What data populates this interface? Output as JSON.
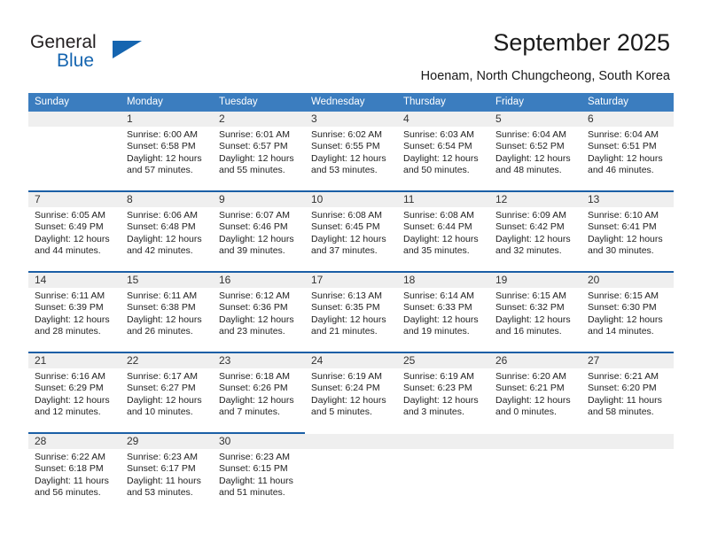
{
  "brand": {
    "name_part1": "General",
    "name_part2": "Blue",
    "accent_color": "#1565b0"
  },
  "header": {
    "title": "September 2025",
    "location": "Hoenam, North Chungcheong, South Korea"
  },
  "calendar": {
    "header_bg": "#3b7dbf",
    "weekday_headers": [
      "Sunday",
      "Monday",
      "Tuesday",
      "Wednesday",
      "Thursday",
      "Friday",
      "Saturday"
    ],
    "weeks": [
      [
        {
          "day": "",
          "sunrise": "",
          "sunset": "",
          "daylight_line1": "",
          "daylight_line2": "",
          "blank": true
        },
        {
          "day": "1",
          "sunrise": "Sunrise: 6:00 AM",
          "sunset": "Sunset: 6:58 PM",
          "daylight_line1": "Daylight: 12 hours",
          "daylight_line2": "and 57 minutes."
        },
        {
          "day": "2",
          "sunrise": "Sunrise: 6:01 AM",
          "sunset": "Sunset: 6:57 PM",
          "daylight_line1": "Daylight: 12 hours",
          "daylight_line2": "and 55 minutes."
        },
        {
          "day": "3",
          "sunrise": "Sunrise: 6:02 AM",
          "sunset": "Sunset: 6:55 PM",
          "daylight_line1": "Daylight: 12 hours",
          "daylight_line2": "and 53 minutes."
        },
        {
          "day": "4",
          "sunrise": "Sunrise: 6:03 AM",
          "sunset": "Sunset: 6:54 PM",
          "daylight_line1": "Daylight: 12 hours",
          "daylight_line2": "and 50 minutes."
        },
        {
          "day": "5",
          "sunrise": "Sunrise: 6:04 AM",
          "sunset": "Sunset: 6:52 PM",
          "daylight_line1": "Daylight: 12 hours",
          "daylight_line2": "and 48 minutes."
        },
        {
          "day": "6",
          "sunrise": "Sunrise: 6:04 AM",
          "sunset": "Sunset: 6:51 PM",
          "daylight_line1": "Daylight: 12 hours",
          "daylight_line2": "and 46 minutes."
        }
      ],
      [
        {
          "day": "7",
          "sunrise": "Sunrise: 6:05 AM",
          "sunset": "Sunset: 6:49 PM",
          "daylight_line1": "Daylight: 12 hours",
          "daylight_line2": "and 44 minutes."
        },
        {
          "day": "8",
          "sunrise": "Sunrise: 6:06 AM",
          "sunset": "Sunset: 6:48 PM",
          "daylight_line1": "Daylight: 12 hours",
          "daylight_line2": "and 42 minutes."
        },
        {
          "day": "9",
          "sunrise": "Sunrise: 6:07 AM",
          "sunset": "Sunset: 6:46 PM",
          "daylight_line1": "Daylight: 12 hours",
          "daylight_line2": "and 39 minutes."
        },
        {
          "day": "10",
          "sunrise": "Sunrise: 6:08 AM",
          "sunset": "Sunset: 6:45 PM",
          "daylight_line1": "Daylight: 12 hours",
          "daylight_line2": "and 37 minutes."
        },
        {
          "day": "11",
          "sunrise": "Sunrise: 6:08 AM",
          "sunset": "Sunset: 6:44 PM",
          "daylight_line1": "Daylight: 12 hours",
          "daylight_line2": "and 35 minutes."
        },
        {
          "day": "12",
          "sunrise": "Sunrise: 6:09 AM",
          "sunset": "Sunset: 6:42 PM",
          "daylight_line1": "Daylight: 12 hours",
          "daylight_line2": "and 32 minutes."
        },
        {
          "day": "13",
          "sunrise": "Sunrise: 6:10 AM",
          "sunset": "Sunset: 6:41 PM",
          "daylight_line1": "Daylight: 12 hours",
          "daylight_line2": "and 30 minutes."
        }
      ],
      [
        {
          "day": "14",
          "sunrise": "Sunrise: 6:11 AM",
          "sunset": "Sunset: 6:39 PM",
          "daylight_line1": "Daylight: 12 hours",
          "daylight_line2": "and 28 minutes."
        },
        {
          "day": "15",
          "sunrise": "Sunrise: 6:11 AM",
          "sunset": "Sunset: 6:38 PM",
          "daylight_line1": "Daylight: 12 hours",
          "daylight_line2": "and 26 minutes."
        },
        {
          "day": "16",
          "sunrise": "Sunrise: 6:12 AM",
          "sunset": "Sunset: 6:36 PM",
          "daylight_line1": "Daylight: 12 hours",
          "daylight_line2": "and 23 minutes."
        },
        {
          "day": "17",
          "sunrise": "Sunrise: 6:13 AM",
          "sunset": "Sunset: 6:35 PM",
          "daylight_line1": "Daylight: 12 hours",
          "daylight_line2": "and 21 minutes."
        },
        {
          "day": "18",
          "sunrise": "Sunrise: 6:14 AM",
          "sunset": "Sunset: 6:33 PM",
          "daylight_line1": "Daylight: 12 hours",
          "daylight_line2": "and 19 minutes."
        },
        {
          "day": "19",
          "sunrise": "Sunrise: 6:15 AM",
          "sunset": "Sunset: 6:32 PM",
          "daylight_line1": "Daylight: 12 hours",
          "daylight_line2": "and 16 minutes."
        },
        {
          "day": "20",
          "sunrise": "Sunrise: 6:15 AM",
          "sunset": "Sunset: 6:30 PM",
          "daylight_line1": "Daylight: 12 hours",
          "daylight_line2": "and 14 minutes."
        }
      ],
      [
        {
          "day": "21",
          "sunrise": "Sunrise: 6:16 AM",
          "sunset": "Sunset: 6:29 PM",
          "daylight_line1": "Daylight: 12 hours",
          "daylight_line2": "and 12 minutes."
        },
        {
          "day": "22",
          "sunrise": "Sunrise: 6:17 AM",
          "sunset": "Sunset: 6:27 PM",
          "daylight_line1": "Daylight: 12 hours",
          "daylight_line2": "and 10 minutes."
        },
        {
          "day": "23",
          "sunrise": "Sunrise: 6:18 AM",
          "sunset": "Sunset: 6:26 PM",
          "daylight_line1": "Daylight: 12 hours",
          "daylight_line2": "and 7 minutes."
        },
        {
          "day": "24",
          "sunrise": "Sunrise: 6:19 AM",
          "sunset": "Sunset: 6:24 PM",
          "daylight_line1": "Daylight: 12 hours",
          "daylight_line2": "and 5 minutes."
        },
        {
          "day": "25",
          "sunrise": "Sunrise: 6:19 AM",
          "sunset": "Sunset: 6:23 PM",
          "daylight_line1": "Daylight: 12 hours",
          "daylight_line2": "and 3 minutes."
        },
        {
          "day": "26",
          "sunrise": "Sunrise: 6:20 AM",
          "sunset": "Sunset: 6:21 PM",
          "daylight_line1": "Daylight: 12 hours",
          "daylight_line2": "and 0 minutes."
        },
        {
          "day": "27",
          "sunrise": "Sunrise: 6:21 AM",
          "sunset": "Sunset: 6:20 PM",
          "daylight_line1": "Daylight: 11 hours",
          "daylight_line2": "and 58 minutes."
        }
      ],
      [
        {
          "day": "28",
          "sunrise": "Sunrise: 6:22 AM",
          "sunset": "Sunset: 6:18 PM",
          "daylight_line1": "Daylight: 11 hours",
          "daylight_line2": "and 56 minutes."
        },
        {
          "day": "29",
          "sunrise": "Sunrise: 6:23 AM",
          "sunset": "Sunset: 6:17 PM",
          "daylight_line1": "Daylight: 11 hours",
          "daylight_line2": "and 53 minutes."
        },
        {
          "day": "30",
          "sunrise": "Sunrise: 6:23 AM",
          "sunset": "Sunset: 6:15 PM",
          "daylight_line1": "Daylight: 11 hours",
          "daylight_line2": "and 51 minutes."
        },
        {
          "day": "",
          "sunrise": "",
          "sunset": "",
          "daylight_line1": "",
          "daylight_line2": "",
          "blank": true
        },
        {
          "day": "",
          "sunrise": "",
          "sunset": "",
          "daylight_line1": "",
          "daylight_line2": "",
          "blank": true
        },
        {
          "day": "",
          "sunrise": "",
          "sunset": "",
          "daylight_line1": "",
          "daylight_line2": "",
          "blank": true
        },
        {
          "day": "",
          "sunrise": "",
          "sunset": "",
          "daylight_line1": "",
          "daylight_line2": "",
          "blank": true
        }
      ]
    ]
  }
}
